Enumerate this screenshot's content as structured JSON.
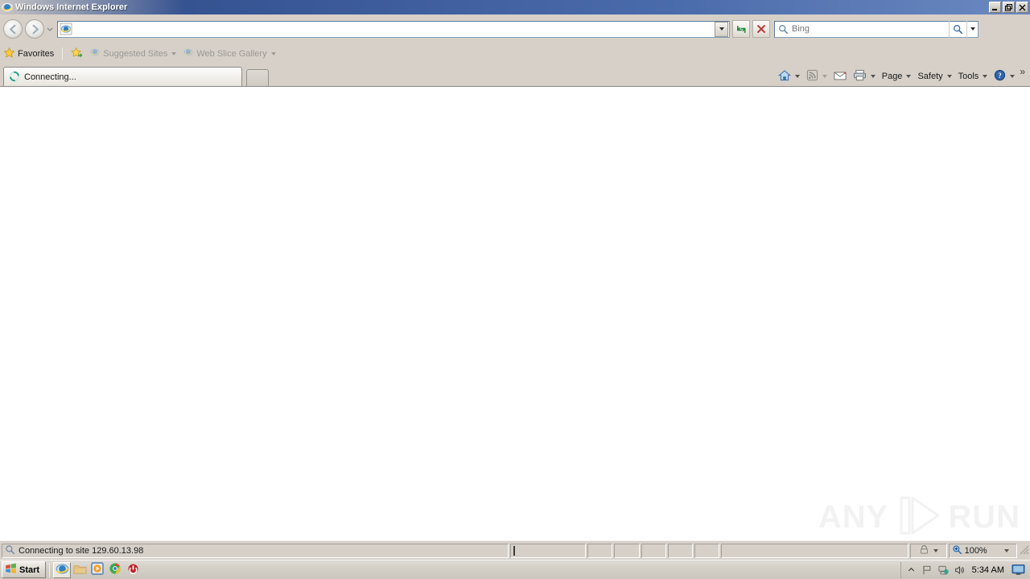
{
  "window": {
    "title": "Windows Internet Explorer",
    "icon": "internet-explorer-icon",
    "controls": {
      "minimize": "Minimize",
      "restore": "Restore",
      "close": "Close"
    }
  },
  "navigation": {
    "back_label": "Back",
    "forward_label": "Forward",
    "history_label": "Recent Pages",
    "address": {
      "value": "",
      "placeholder": "",
      "favicon": "internet-explorer-icon",
      "dropdown_label": "Address dropdown"
    },
    "refresh_label": "Refresh",
    "stop_label": "Stop",
    "search": {
      "value": "",
      "placeholder": "Bing",
      "icon": "search-icon",
      "go_label": "Search",
      "dropdown_label": "Search provider"
    }
  },
  "favorites_bar": {
    "favorites_label": "Favorites",
    "items": [
      {
        "label": "Suggested Sites",
        "icon": "internet-explorer-icon",
        "dimmed": true
      },
      {
        "label": "Web Slice Gallery",
        "icon": "internet-explorer-icon",
        "dimmed": true
      }
    ],
    "add_favorite_icon": "star-add-icon",
    "favorites_icon": "star-icon"
  },
  "tabs": {
    "active": {
      "label": "Connecting...",
      "icon": "loading-spinner-icon"
    },
    "new_tab_label": "New Tab"
  },
  "command_bar": {
    "items": [
      {
        "name": "home",
        "icon": "home-icon",
        "label": "",
        "caret": true
      },
      {
        "name": "feeds",
        "icon": "rss-icon",
        "label": "",
        "caret": true
      },
      {
        "name": "mail",
        "icon": "mail-icon",
        "label": "",
        "caret": false
      },
      {
        "name": "print",
        "icon": "printer-icon",
        "label": "",
        "caret": true
      },
      {
        "name": "page",
        "icon": "",
        "label": "Page",
        "caret": true
      },
      {
        "name": "safety",
        "icon": "",
        "label": "Safety",
        "caret": true
      },
      {
        "name": "tools",
        "icon": "",
        "label": "Tools",
        "caret": true
      },
      {
        "name": "help",
        "icon": "help-icon",
        "label": "",
        "caret": true
      }
    ],
    "overflow_label": "»"
  },
  "content": {
    "watermark": {
      "text_left": "ANY",
      "text_right": "RUN",
      "logo_icon": "play-triangle-icon"
    }
  },
  "status_bar": {
    "text": "Connecting to site 129.60.13.98",
    "icon": "search-globe-icon",
    "security_zone_icon": "lock-zone-icon",
    "zoom_icon": "zoom-in-icon",
    "zoom_level": "100%",
    "resize_grip": "resize-grip-icon"
  },
  "taskbar": {
    "start_label": "Start",
    "start_icon": "windows-flag-icon",
    "quick_launch": [
      {
        "name": "internet-explorer",
        "icon": "internet-explorer-icon",
        "active": true
      },
      {
        "name": "file-explorer",
        "icon": "folder-icon",
        "active": false
      },
      {
        "name": "media-player",
        "icon": "media-player-icon",
        "active": false
      },
      {
        "name": "chrome",
        "icon": "chrome-icon",
        "active": false
      },
      {
        "name": "shutdown",
        "icon": "power-icon",
        "active": false
      }
    ],
    "tray": {
      "expand_icon": "chevron-up-icon",
      "icons": [
        {
          "name": "flag",
          "icon": "flag-icon"
        },
        {
          "name": "network",
          "icon": "network-icon"
        },
        {
          "name": "volume",
          "icon": "volume-icon"
        }
      ],
      "time": "5:34 AM",
      "show_desktop_icon": "show-desktop-icon"
    }
  },
  "colors": {
    "titlebar_start": "#2d4a86",
    "titlebar_end": "#6b88c0",
    "toolbar_bg": "#d6d0c9",
    "content_bg": "#ffffff",
    "field_border": "#5c7b99",
    "watermark": "#f2f2f2"
  }
}
